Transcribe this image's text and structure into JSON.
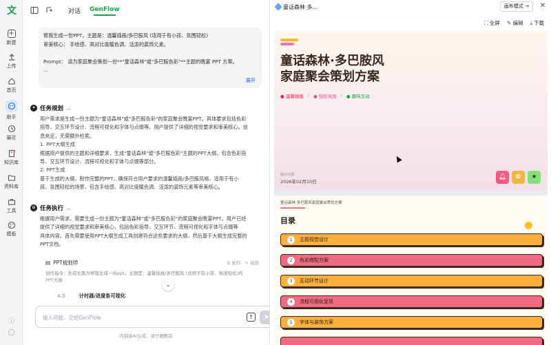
{
  "rail": {
    "logo": "文",
    "items": [
      {
        "label": "新建",
        "icon": "plus-square-icon"
      },
      {
        "label": "上传",
        "icon": "upload-icon"
      },
      {
        "label": "首页",
        "icon": "home-icon"
      },
      {
        "label": "助手",
        "icon": "assistant-icon"
      },
      {
        "label": "最近",
        "icon": "clock-icon"
      },
      {
        "label": "知识库",
        "icon": "book-icon"
      },
      {
        "label": "资料库",
        "icon": "folder-icon"
      },
      {
        "label": "工具",
        "icon": "toolbox-icon"
      },
      {
        "label": "模板",
        "icon": "palette-icon"
      }
    ]
  },
  "chat": {
    "tabs": [
      "对话",
      "GenFlow"
    ],
    "prompt_lines": [
      "帮我生成一份PPT，主题是：温馨插画/多巴胺风 (适用于有小孩、氛围轻松)",
      "审美核心： 手绘感、高对比度暖色调、活泼的装饰元素。",
      "",
      "Prompt： 请为家庭聚会策划一份**\"童话森林\"或\"多巴胺色彩\"**主题的晚宴 PPT 方案。",
      "..."
    ],
    "expand_label": "展开",
    "plan": {
      "title": "任务规划",
      "lines": [
        "用户需求是生成一份主题为\"童话森林\"或\"多巴胺色彩\"的家庭聚会晚宴PPT。具体要求包括色彩",
        "指导、交互环节设计、流程可视化和字体与点缀等。用户提供了详细的视觉要求和审美核心。信",
        "息充足，无需额外检索。",
        "1. PPT大纲生成",
        "根据用户提供的主题和详细要求，生成\"童话森林\"或\"多巴胺色彩\"主题的PPT大纲，包含色彩指",
        "导、交互环节设计、流程可视化和字体与点缀等部分。",
        "2. PPT生成",
        "基于生成的大纲，制作完整的PPT，确保符合用户要求的温馨插画/多巴胺风格，适用于有小",
        "孩、氛围轻松的场景，包含手绘感、高对比度暖色调、活泼的装饰元素等审美核心。"
      ]
    },
    "exec": {
      "title": "任务执行",
      "lines": [
        "根据用户需求，需要生成一份主题为\"童话森林\"或\"多巴胺色彩\"的家庭聚会晚宴PPT。用户已经",
        "提供了详细的视觉要求和审美核心，包括色彩指导、交互环节、流程可视化和字体与点缀等",
        "具体内容。首先需要使用PPT大纲生成工具创建符合这些要求的大纲，然后基于大纲生成完整的",
        "PPT文档。"
      ]
    },
    "tool": {
      "title": "PPT规划师",
      "copy_label": "复制",
      "edit_label": "编辑",
      "desc_lines": [
        "创作指令：生成主题为帮我生成一份ppt，主题是：温馨插画/多巴胺风 (适用于有小孩、氛围轻松)的",
        "PPT大纲"
      ]
    },
    "step": {
      "num": "4.3",
      "text": "计时器/进度条可视化"
    },
    "input_placeholder": "输入问题，交给GenFlow",
    "disclaimer": "内容由AI生成，请仔细甄别"
  },
  "preview": {
    "tab_title": "童话森林·多...",
    "mode_label": "画布模式",
    "tools": [
      "全屏",
      "编辑",
      "下载"
    ],
    "slide1": {
      "title_line1": "童话森林·多巴胺风",
      "title_line2": "家庭聚会策划方案",
      "tags": [
        "温馨插画",
        "轻松氛围",
        "趣味互动"
      ],
      "date_label": "策划日期",
      "date": "2026年02月10日",
      "icon_colors": [
        "#f25a82",
        "#f9b43b",
        "#86e07a"
      ]
    },
    "slide2": {
      "header": "童话森林·多巴胺风家庭聚会策划方案",
      "title": "目录",
      "items": [
        {
          "num": "1",
          "label": "主题视觉设计",
          "color": "orange"
        },
        {
          "num": "2",
          "label": "色彩搭配方案",
          "color": "pink"
        },
        {
          "num": "3",
          "label": "互动环节设计",
          "color": "orange"
        },
        {
          "num": "4",
          "label": "流程可视化呈现",
          "color": "pink"
        },
        {
          "num": "5",
          "label": "字体与装饰方案",
          "color": "orange"
        }
      ]
    }
  },
  "colors": {
    "brand": "#16a34a",
    "link": "#2563eb",
    "accent_orange": "#fbb040",
    "accent_pink": "#f06b84"
  }
}
